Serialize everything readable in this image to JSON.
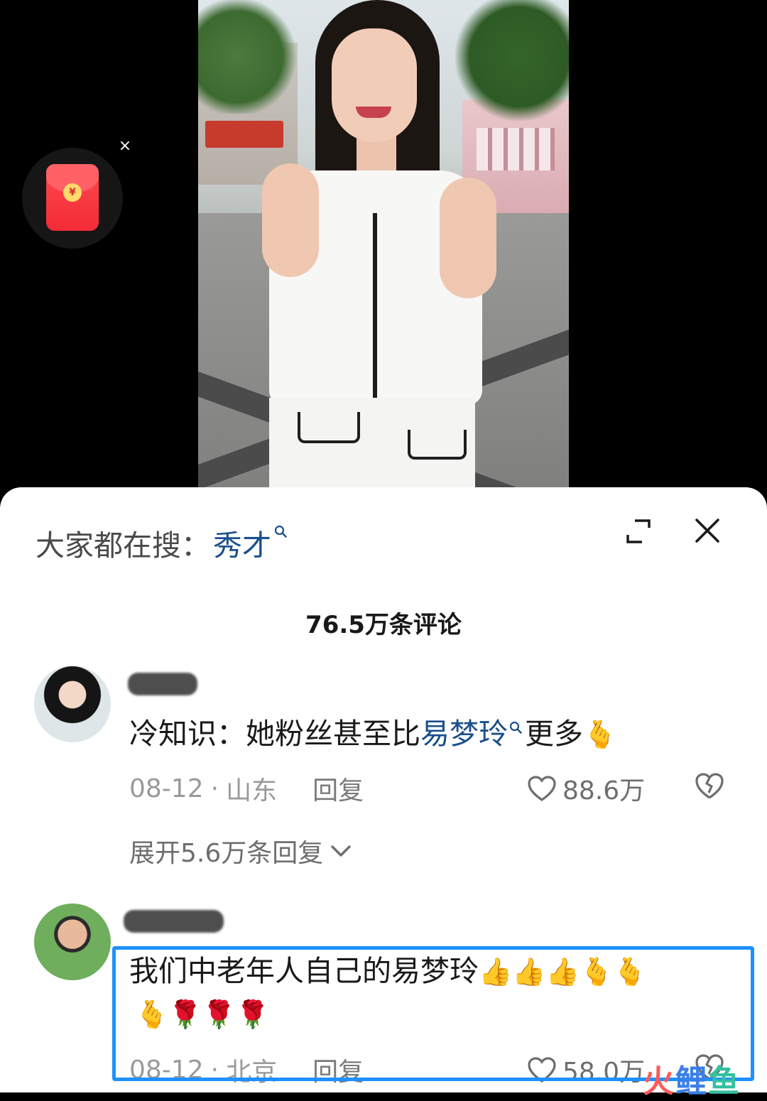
{
  "redpacket": {
    "coin_symbol": "¥",
    "close_symbol": "×"
  },
  "search_bar": {
    "label": "大家都在搜：",
    "term": "秀才"
  },
  "comments_header": {
    "count_label": "76.5万条评论"
  },
  "comments": [
    {
      "text_prefix": "冷知识：她粉丝甚至比",
      "text_link": "易梦玲",
      "text_suffix": "更多",
      "emoji": "🫰",
      "date": "08-12",
      "separator": "·",
      "location": "山东",
      "reply_label": "回复",
      "like_count": "88.6万",
      "expand_replies_label": "展开5.6万条回复"
    },
    {
      "text_line1": "我们中老年人自己的易梦玲",
      "emoji_line1": "👍👍👍🫰🫰",
      "emoji_line2": "🫰🌹🌹🌹",
      "date": "08-12",
      "separator": "·",
      "location": "北京",
      "reply_label": "回复",
      "like_count": "58.0万"
    }
  ],
  "watermark": {
    "part1": "火",
    "part2": "鲤",
    "part3": "鱼"
  },
  "colors": {
    "link_blue": "#1b4f8a",
    "highlight_border": "#1e90ff",
    "redpacket_red": "#f22b37"
  }
}
